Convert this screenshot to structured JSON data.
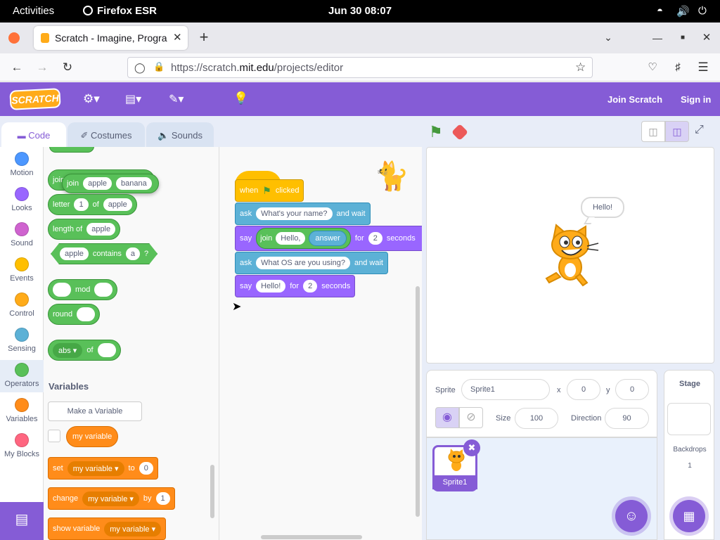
{
  "gnome": {
    "activities": "Activities",
    "app": "Firefox ESR",
    "clock": "Jun 30  08:07"
  },
  "browser": {
    "tab_title": "Scratch - Imagine, Progra",
    "url_prefix": "https://scratch.",
    "url_domain": "mit.edu",
    "url_path": "/projects/editor"
  },
  "menubar": {
    "logo": "SCRATCH",
    "join": "Join Scratch",
    "signin": "Sign in"
  },
  "editor_tabs": {
    "code": "Code",
    "costumes": "Costumes",
    "sounds": "Sounds"
  },
  "categories": [
    {
      "label": "Motion",
      "color": "#4c97ff"
    },
    {
      "label": "Looks",
      "color": "#9966ff"
    },
    {
      "label": "Sound",
      "color": "#cf63cf"
    },
    {
      "label": "Events",
      "color": "#ffbf00"
    },
    {
      "label": "Control",
      "color": "#ffab19"
    },
    {
      "label": "Sensing",
      "color": "#5cb1d6"
    },
    {
      "label": "Operators",
      "color": "#59c059"
    },
    {
      "label": "Variables",
      "color": "#ff8c1a"
    },
    {
      "label": "My Blocks",
      "color": "#ff6680"
    }
  ],
  "palette": {
    "join_label": "join",
    "join_a": "apple",
    "join_b": "banana",
    "letter_label": "letter",
    "letter_n": "1",
    "of_label": "of",
    "letter_word": "apple",
    "length_label": "length of",
    "length_word": "apple",
    "contains_a": "apple",
    "contains_label": "contains",
    "contains_b": "a",
    "contains_q": "?",
    "mod_label": "mod",
    "round_label": "round",
    "abs_label": "abs",
    "abs_of": "of",
    "variables_heading": "Variables",
    "make_variable": "Make a Variable",
    "my_variable": "my variable",
    "set_label": "set",
    "set_to": "to",
    "set_value": "0",
    "change_label": "change",
    "change_by": "by",
    "change_value": "1",
    "show_label": "show variable"
  },
  "script": {
    "when": "when",
    "clicked": "clicked",
    "ask1_label": "ask",
    "ask1_text": "What's your name?",
    "ask1_wait": "and wait",
    "say1_label": "say",
    "say1_join": "join",
    "say1_hello": "Hello,",
    "say1_answer": "answer",
    "say1_for": "for",
    "say1_secs": "2",
    "say1_seconds": "seconds",
    "ask2_label": "ask",
    "ask2_text": "What OS are you using?",
    "ask2_wait": "and wait",
    "say2_label": "say",
    "say2_text": "Hello!",
    "say2_for": "for",
    "say2_secs": "2",
    "say2_seconds": "seconds"
  },
  "stage": {
    "speech": "Hello!"
  },
  "sprite_info": {
    "sprite_label": "Sprite",
    "sprite_name": "Sprite1",
    "x_label": "x",
    "x_value": "0",
    "y_label": "y",
    "y_value": "0",
    "size_label": "Size",
    "size_value": "100",
    "direction_label": "Direction",
    "direction_value": "90"
  },
  "sprite_list": [
    {
      "name": "Sprite1"
    }
  ],
  "stage_panel": {
    "title": "Stage",
    "backdrops_label": "Backdrops",
    "backdrops_count": "1"
  },
  "colors": {
    "scratch_purple": "#855cd6",
    "operators": "#59c059",
    "looks": "#9966ff",
    "sensing": "#5cb1d6",
    "variables": "#ff8c1a",
    "events": "#ffbf00"
  }
}
